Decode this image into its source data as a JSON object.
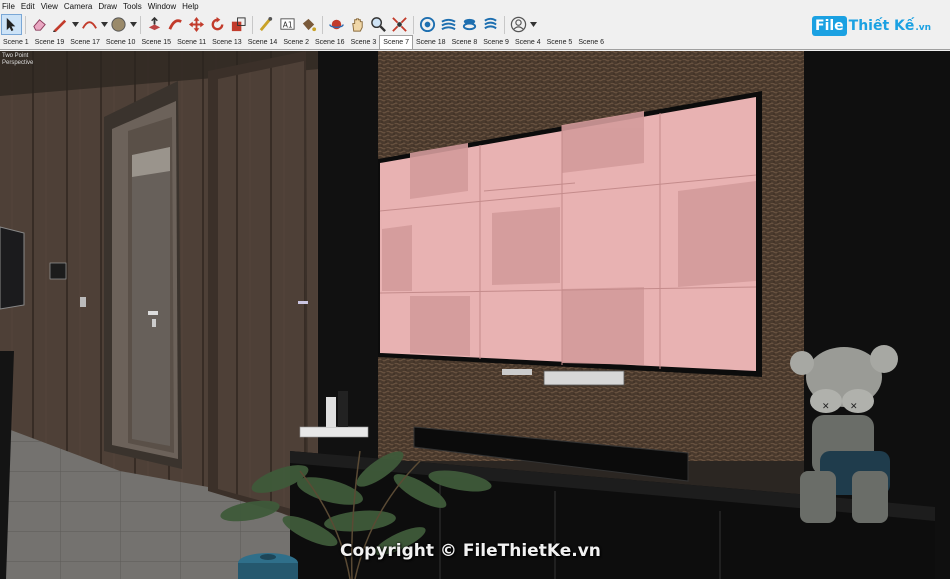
{
  "menu": [
    "File",
    "Edit",
    "View",
    "Camera",
    "Draw",
    "Tools",
    "Window",
    "Help"
  ],
  "toolbar": [
    {
      "icon": "select-arrow-icon",
      "selected": true
    },
    {
      "icon": "eraser-icon"
    },
    {
      "icon": "pencil-line-icon",
      "dropdown": true
    },
    {
      "icon": "arc-icon",
      "dropdown": true
    },
    {
      "icon": "shape-circle-icon",
      "dropdown": true
    },
    {
      "icon": "push-pull-icon"
    },
    {
      "icon": "follow-me-icon"
    },
    {
      "icon": "move-icon"
    },
    {
      "icon": "rotate-icon"
    },
    {
      "icon": "scale-icon"
    },
    {
      "icon": "tape-measure-icon"
    },
    {
      "icon": "text-icon"
    },
    {
      "icon": "paint-bucket-icon"
    },
    {
      "icon": "orbit-icon"
    },
    {
      "icon": "pan-icon"
    },
    {
      "icon": "zoom-icon"
    },
    {
      "icon": "zoom-extents-icon"
    },
    {
      "icon": "3d-warehouse-icon"
    },
    {
      "icon": "extension-warehouse-icon"
    },
    {
      "icon": "layout-icon"
    },
    {
      "icon": "extension-manager-icon"
    },
    {
      "icon": "account-icon",
      "dropdown": true
    }
  ],
  "logo": {
    "file": "File",
    "rest": "Thiết Kế",
    "vn": ".vn"
  },
  "scenes": [
    "Scene 1",
    "Scene 19",
    "Scene 17",
    "Scene 10",
    "Scene 15",
    "Scene 11",
    "Scene 13",
    "Scene 14",
    "Scene 2",
    "Scene 16",
    "Scene 3",
    "Scene 7",
    "Scene 18",
    "Scene 8",
    "Scene 9",
    "Scene 4",
    "Scene 5",
    "Scene 6"
  ],
  "active_scene": "Scene 7",
  "viewport": {
    "camera_line1": "Two Point",
    "camera_line2": "Perspective",
    "watermark": "Copyright © FileThietKe.vn"
  }
}
